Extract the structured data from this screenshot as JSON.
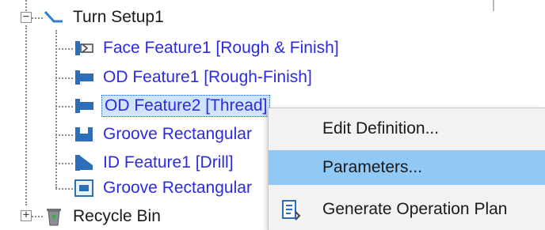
{
  "tree": {
    "setup": {
      "label": "Turn Setup1",
      "expander": "−",
      "icon": "turn-setup-icon"
    },
    "features": [
      {
        "label": "Face Feature1 [Rough & Finish]",
        "icon": "face-feature-icon",
        "selected": false
      },
      {
        "label": "OD Feature1 [Rough-Finish]",
        "icon": "od-feature-icon",
        "selected": false
      },
      {
        "label": "OD Feature2 [Thread]",
        "icon": "od-feature-icon",
        "selected": true
      },
      {
        "label": "Groove Rectangular",
        "icon": "groove-feature-icon",
        "selected": false
      },
      {
        "label": "ID Feature1 [Drill]",
        "icon": "id-feature-icon",
        "selected": false
      },
      {
        "label": "Groove Rectangular",
        "icon": "groove-feature-icon",
        "selected": false
      }
    ],
    "recycle_bin": {
      "label": "Recycle Bin",
      "expander": "+",
      "icon": "recycle-bin-icon"
    }
  },
  "context_menu": {
    "items": [
      {
        "label": "Edit Definition...",
        "icon": null,
        "highlighted": false
      },
      {
        "label": "Parameters...",
        "icon": null,
        "highlighted": true
      },
      {
        "label": "Generate Operation Plan",
        "icon": "operation-plan-icon",
        "highlighted": false
      }
    ]
  },
  "colors": {
    "feature_text": "#2d2be0",
    "selection_bg": "#cfe3fb",
    "menu_bg": "#f2f2f2",
    "menu_highlight": "#91c8f4"
  }
}
